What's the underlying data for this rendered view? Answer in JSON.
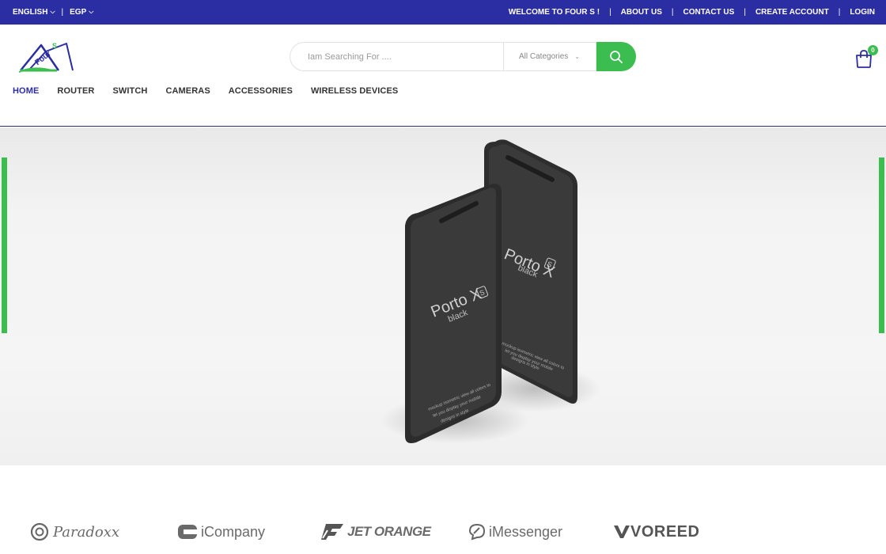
{
  "topbar": {
    "language": "ENGLISH",
    "currency": "EGP",
    "divider": "|",
    "links": [
      {
        "label": "WELCOME TO FOUR S !"
      },
      {
        "label": "ABOUT US"
      },
      {
        "label": "CONTACT US"
      },
      {
        "label": "CREATE ACCOUNT"
      },
      {
        "label": "LOGIN"
      }
    ]
  },
  "header": {
    "logo_text": "FourS",
    "search": {
      "placeholder": "Iam Searching For ....",
      "category": "All Categories"
    },
    "cart_count": "0"
  },
  "nav": {
    "items": [
      {
        "label": "HOME",
        "active": true
      },
      {
        "label": "ROUTER"
      },
      {
        "label": "SWITCH"
      },
      {
        "label": "CAMERAS"
      },
      {
        "label": "ACCESSORIES"
      },
      {
        "label": "WIRELESS DEVICES"
      }
    ]
  },
  "hero": {
    "phone_brand": "Porto X",
    "phone_badge": "S",
    "phone_color": "black",
    "phone_caption_1": "mockup isometric view all colors to",
    "phone_caption_2": "let you display your mobile",
    "phone_caption_3": "designs in style",
    "accent_color": "#3cbd4f"
  },
  "brands": [
    {
      "label": "Paradoxx",
      "icon": "paradoxx-icon"
    },
    {
      "label": "iCompany",
      "icon": "icompany-icon"
    },
    {
      "label": "JET ORANGE",
      "icon": "jet-orange-icon"
    },
    {
      "label": "iMessenger",
      "icon": "imessenger-icon"
    },
    {
      "label": "VOREED",
      "icon": "voreed-icon"
    }
  ],
  "colors": {
    "topbar": "#2b2da3",
    "green": "#3cbd4f"
  }
}
